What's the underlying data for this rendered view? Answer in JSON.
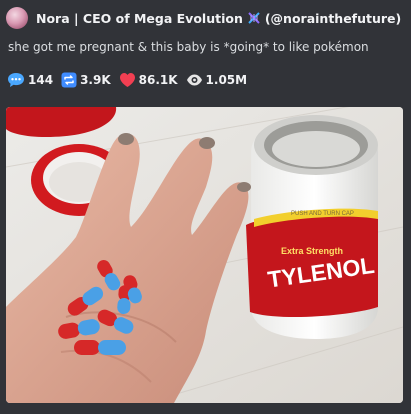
{
  "post": {
    "author_display": "Nora | CEO of Mega Evolution",
    "author_handle": "(@norainthefuture)",
    "text": "she got me pregnant & this baby is *going* to like pokémon",
    "stats": {
      "replies": "144",
      "reposts": "3.9K",
      "likes": "86.1K",
      "views": "1.05M"
    },
    "icons": {
      "avatar": "profile-avatar",
      "dna": "dna-emoji",
      "replies": "speech-bubble-icon",
      "reposts": "repost-icon",
      "likes": "heart-icon",
      "views": "eye-icon"
    },
    "image": {
      "bottle_label_brand": "TYLENOL",
      "bottle_label_top": "PUSH AND TURN CAP",
      "bottle_label_sub": "Extra Strength"
    }
  },
  "colors": {
    "background": "#313338",
    "text": "#dbdee1",
    "author": "#f2f3f5",
    "reply_icon": "#4aa8ff",
    "repost_icon": "#3f8cff",
    "heart": "#f23f52",
    "eye": "#e6e6e6",
    "tylenol_red": "#c4161c"
  }
}
